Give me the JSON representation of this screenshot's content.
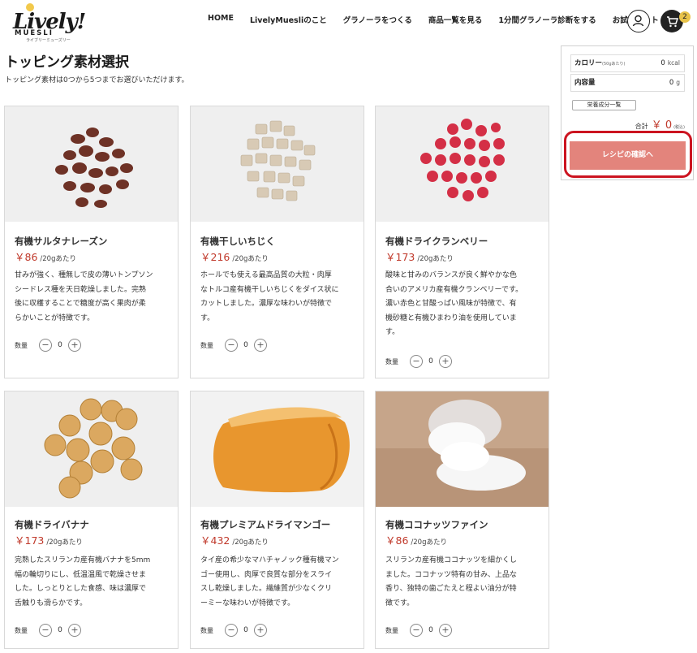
{
  "header": {
    "logo_text": "Lively!",
    "logo_sub": "MUESLI",
    "logo_tag": "ライブリーミューズリー",
    "nav": [
      "HOME",
      "LivelyMuesliのこと",
      "グラノーラをつくる",
      "商品一覧を見る",
      "1分間グラノーラ診断をする",
      "お試しセット"
    ],
    "cart_count": "2"
  },
  "page": {
    "title": "トッピング素材選択",
    "subtitle": "トッピング素材は0つから5つまでお選びいただけます。"
  },
  "qty_label": "数量",
  "products": [
    {
      "name": "有機サルタナレーズン",
      "price": "￥86",
      "per": "/20gあたり",
      "desc_lines": [
        "甘みが強く、種無しで皮の薄いトンプソン",
        "シードレス種を天日乾燥しました。完熟",
        "後に収穫することで糖度が高く果肉が柔",
        "らかいことが特徴です。"
      ],
      "qty": "0",
      "img_color": "#7a3a2a"
    },
    {
      "name": "有機干しいちじく",
      "price": "￥216",
      "per": "/20gあたり",
      "desc_lines": [
        "ホールでも使える最高品質の大粒・肉厚",
        "なトルコ産有機干しいちじくをダイス状に",
        "カットしました。濃厚な味わいが特徴で",
        "す。"
      ],
      "qty": "0",
      "img_color": "#cfc0a8"
    },
    {
      "name": "有機ドライクランベリー",
      "price": "￥173",
      "per": "/20gあたり",
      "desc_lines": [
        "酸味と甘みのバランスが良く鮮やかな色",
        "合いのアメリカ産有機クランベリーです。",
        "濃い赤色と甘酸っぱい風味が特徴で、有",
        "機砂糖と有機ひまわり油を使用していま",
        "す。"
      ],
      "qty": "0",
      "img_color": "#d9324a"
    },
    {
      "name": "有機ドライバナナ",
      "price": "￥173",
      "per": "/20gあたり",
      "desc_lines": [
        "完熟したスリランカ産有機バナナを5mm",
        "幅の輪切りにし、低温温風で乾燥させま",
        "した。しっとりとした食感、味は濃厚で",
        "舌触りも滑らかです。"
      ],
      "qty": "0",
      "img_color": "#d9a85a"
    },
    {
      "name": "有機プレミアムドライマンゴー",
      "price": "￥432",
      "per": "/20gあたり",
      "desc_lines": [
        "タイ産の希少なマハチャノック種有機マン",
        "ゴー使用し、肉厚で良質な部分をスライ",
        "スし乾燥しました。繊維質が少なくクリ",
        "ーミーな味わいが特徴です。"
      ],
      "qty": "0",
      "img_color": "#e89a30"
    },
    {
      "name": "有機ココナッツファイン",
      "price": "￥86",
      "per": "/20gあたり",
      "desc_lines": [
        "スリランカ産有機ココナッツを細かくし",
        "ました。ココナッツ特有の甘み、上品な",
        "香り、独特の歯ごたえと程よい油分が特",
        "徴です。"
      ],
      "qty": "0",
      "img_color": "#f2f2f2"
    }
  ],
  "sidebar": {
    "calorie_label": "カロリー",
    "calorie_note": "(50gあたり)",
    "calorie_value": "0",
    "calorie_unit": "kcal",
    "volume_label": "内容量",
    "volume_value": "0",
    "volume_unit": "g",
    "nutrition_button": "栄養成分一覧",
    "total_label": "合計",
    "total_value": "￥ 0",
    "tax_note": "(税込)",
    "recipe_button": "レシピの確認へ"
  },
  "colors": {
    "accent": "#c0392b",
    "button": "#e3847c",
    "highlight": "#cc1420"
  }
}
